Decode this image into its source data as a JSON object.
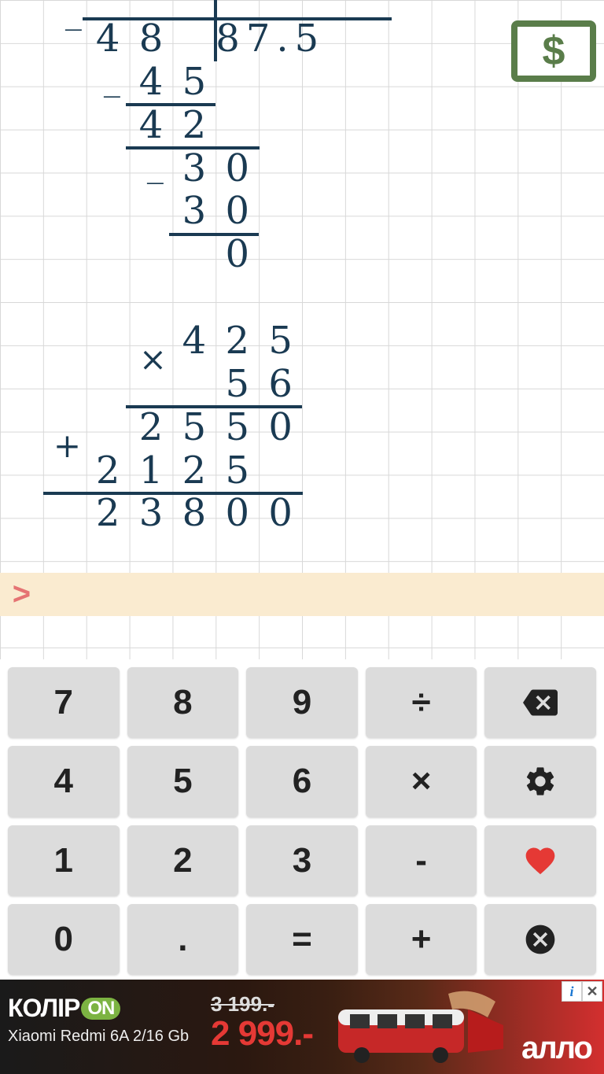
{
  "currency_symbol": "$",
  "calculation": {
    "division": {
      "row0": {
        "c2": "4",
        "c3": "8"
      },
      "quotient": "87.5",
      "row2": {
        "op": "_",
        "c3": "4",
        "c4": "5"
      },
      "row3": {
        "c3": "4",
        "c4": "2"
      },
      "row4": {
        "op": "_",
        "c4": "3",
        "c5": "0"
      },
      "row5": {
        "c4": "3",
        "c5": "0"
      },
      "row6": {
        "c5": "0"
      },
      "vline_note": "_"
    },
    "multiplication": {
      "row8": {
        "op": "×",
        "c4": "4",
        "c5": "2",
        "c6": "5"
      },
      "row9": {
        "c5": "5",
        "c6": "6"
      },
      "row10": {
        "plus": "+",
        "c3": "2",
        "c4": "5",
        "c5": "5",
        "c6": "0"
      },
      "row11": {
        "c2": "2",
        "c3": "1",
        "c4": "2",
        "c5": "5"
      },
      "row12": {
        "c2": "2",
        "c3": "3",
        "c4": "8",
        "c5": "0",
        "c6": "0"
      }
    }
  },
  "prompt": ">",
  "keypad": {
    "r1c1": "7",
    "r1c2": "8",
    "r1c3": "9",
    "r1c4": "÷",
    "r2c1": "4",
    "r2c2": "5",
    "r2c3": "6",
    "r2c4": "×",
    "r3c1": "1",
    "r3c2": "2",
    "r3c3": "3",
    "r3c4": "-",
    "r4c1": "0",
    "r4c2": ".",
    "r4c3": "=",
    "r4c4": "+"
  },
  "ad": {
    "brand_prefix": "КОЛІР",
    "brand_on": "ON",
    "product": "Xiaomi Redmi 6A 2/16 Gb",
    "old_price": "3 199.-",
    "new_price": "2 999.-",
    "shop_brand": "алло",
    "info": "i",
    "close": "✕"
  }
}
